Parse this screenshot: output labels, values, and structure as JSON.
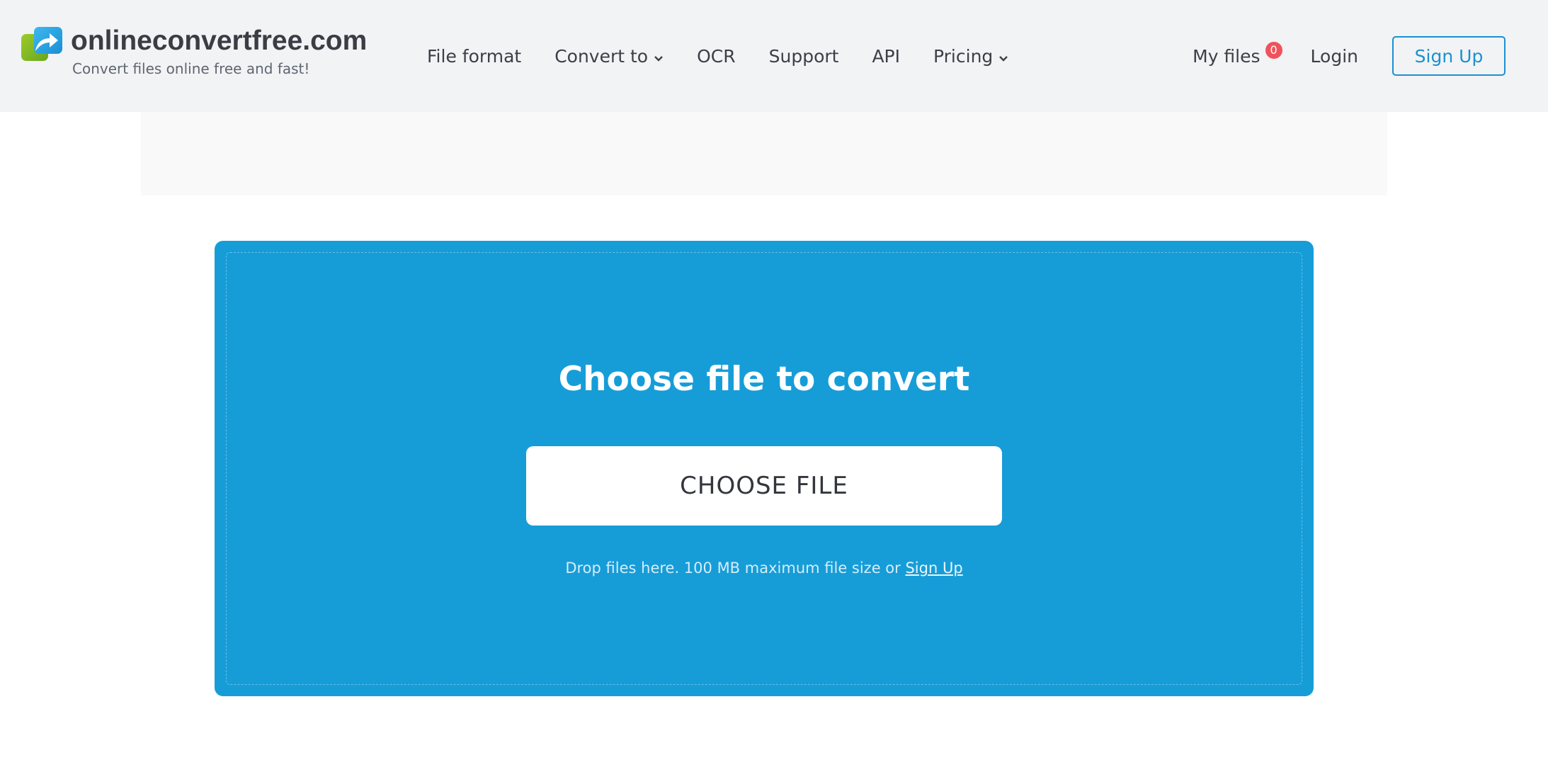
{
  "header": {
    "logo_title": "onlineconvertfree.com",
    "logo_subtitle": "Convert files online free and fast!",
    "nav": [
      {
        "label": "File format",
        "dropdown": false
      },
      {
        "label": "Convert to",
        "dropdown": true
      },
      {
        "label": "OCR",
        "dropdown": false
      },
      {
        "label": "Support",
        "dropdown": false
      },
      {
        "label": "API",
        "dropdown": false
      },
      {
        "label": "Pricing",
        "dropdown": true
      }
    ],
    "my_files_label": "My files",
    "my_files_count": "0",
    "login_label": "Login",
    "signup_label": "Sign Up"
  },
  "upload": {
    "title": "Choose file to convert",
    "button_label": "CHOOSE FILE",
    "drop_note": "Drop files here. 100 MB maximum file size or",
    "signup_link": "Sign Up"
  },
  "colors": {
    "header_bg": "#f2f3f5",
    "upload_bg": "#169dd8",
    "accent": "#1a91d1",
    "badge": "#f0525b"
  },
  "icons": [
    "logo-arrow-icon",
    "chevron-down-icon"
  ]
}
